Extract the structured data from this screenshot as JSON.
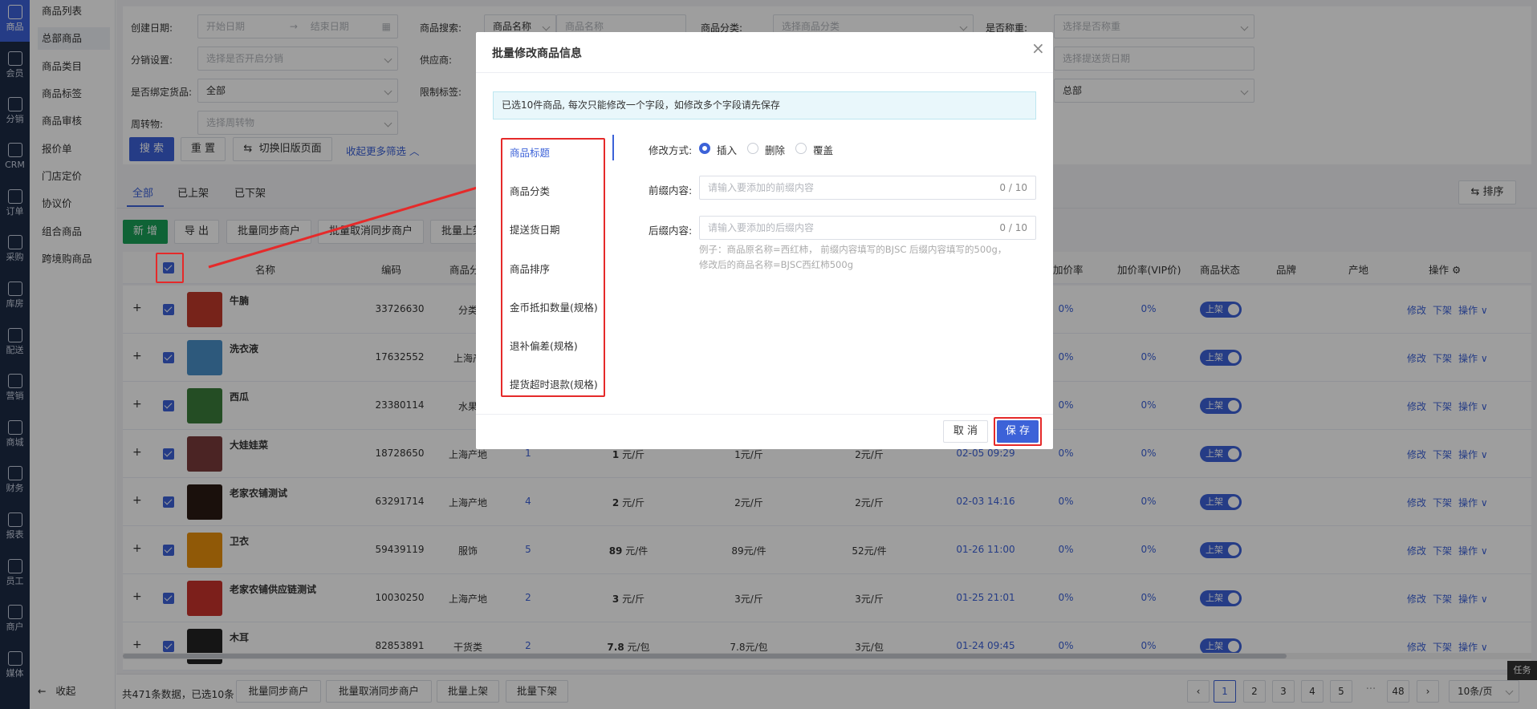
{
  "nav": {
    "items": [
      {
        "label": "商品",
        "icon": "goods-icon",
        "active": true
      },
      {
        "label": "会员",
        "icon": "member-icon"
      },
      {
        "label": "分销",
        "icon": "distribution-icon"
      },
      {
        "label": "CRM",
        "icon": "crm-icon"
      },
      {
        "label": "订单",
        "icon": "order-icon"
      },
      {
        "label": "采购",
        "icon": "purchase-icon"
      },
      {
        "label": "库房",
        "icon": "warehouse-icon"
      },
      {
        "label": "配送",
        "icon": "delivery-icon"
      },
      {
        "label": "营销",
        "icon": "marketing-icon"
      },
      {
        "label": "商城",
        "icon": "mall-icon"
      },
      {
        "label": "财务",
        "icon": "finance-icon"
      },
      {
        "label": "报表",
        "icon": "report-icon"
      },
      {
        "label": "员工",
        "icon": "staff-icon"
      },
      {
        "label": "商户",
        "icon": "merchant-icon"
      },
      {
        "label": "媒体",
        "icon": "media-icon"
      }
    ]
  },
  "subnav": {
    "items": [
      "商品列表",
      "总部商品",
      "商品类目",
      "商品标签",
      "商品审核",
      "报价单",
      "门店定价",
      "协议价",
      "组合商品",
      "跨境购商品"
    ],
    "active_index": 1,
    "collapse": "收起"
  },
  "filters": {
    "create_date": {
      "label": "创建日期:",
      "start": "开始日期",
      "sep": "→",
      "end": "结束日期"
    },
    "search": {
      "label": "商品搜索:",
      "type": "商品名称",
      "placeholder": "商品名称"
    },
    "category": {
      "label": "商品分类:",
      "placeholder": "选择商品分类"
    },
    "weigh": {
      "label": "是否称重:",
      "placeholder": "选择是否称重"
    },
    "distribution": {
      "label": "分销设置:",
      "placeholder": "选择是否开启分销"
    },
    "supplier": {
      "label": "供应商:"
    },
    "delivery_date": {
      "placeholder": "选择提送货日期"
    },
    "bind_goods": {
      "label": "是否绑定货品:",
      "value": "全部"
    },
    "limit_tag": {
      "label": "限制标签:"
    },
    "extra_select": {
      "value": "总部"
    },
    "turnover": {
      "label": "周转物:",
      "placeholder": "选择周转物"
    },
    "search_btn": "搜 索",
    "reset_btn": "重 置",
    "switch_btn": "切换旧版页面",
    "collapse_link": "收起更多筛选"
  },
  "tabs": [
    "全部",
    "已上架",
    "已下架"
  ],
  "sort_btn": "排序",
  "toolbar": {
    "add": "新 增",
    "export": "导 出",
    "sync": "批量同步商户",
    "unsync": "批量取消同步商户",
    "shelf": "批量上架"
  },
  "table": {
    "headers": {
      "name": "名称",
      "code": "编码",
      "category": "商品分",
      "markup": "加价率",
      "markup_vip": "加价率(VIP价)",
      "status": "商品状态",
      "brand": "品牌",
      "origin": "产地",
      "ops": "操作"
    },
    "rows": [
      {
        "name": "牛腩",
        "code": "33726630",
        "category": "分类",
        "sort": "",
        "price_num": "",
        "price_unit": "",
        "p2": "",
        "p3": "",
        "date": "",
        "markup": "0%",
        "vip": "0%",
        "status": "上架",
        "thumb": "#c0392b"
      },
      {
        "name": "洗衣液",
        "code": "17632552",
        "category": "上海产",
        "sort": "",
        "price_num": "",
        "price_unit": "",
        "p2": "",
        "p3": "",
        "date": "",
        "markup": "0%",
        "vip": "0%",
        "status": "上架",
        "thumb": "#4a90c8"
      },
      {
        "name": "西瓜",
        "code": "23380114",
        "category": "水果",
        "sort": "",
        "price_num": "",
        "price_unit": "",
        "p2": "",
        "p3": "",
        "date": "",
        "markup": "0%",
        "vip": "0%",
        "status": "上架",
        "thumb": "#3b7d3b"
      },
      {
        "name": "大娃娃菜",
        "code": "18728650",
        "category": "上海产地",
        "sort": "1",
        "price_num": "1",
        "price_unit": "元/斤",
        "p2": "1元/斤",
        "p3": "2元/斤",
        "date": "02-05 09:29",
        "markup": "0%",
        "vip": "0%",
        "status": "上架",
        "thumb": "#7a3a3a"
      },
      {
        "name": "老家农铺测试",
        "code": "63291714",
        "category": "上海产地",
        "sort": "4",
        "price_num": "2",
        "price_unit": "元/斤",
        "p2": "2元/斤",
        "p3": "2元/斤",
        "date": "02-03 14:16",
        "markup": "0%",
        "vip": "0%",
        "status": "上架",
        "thumb": "#2b1a14"
      },
      {
        "name": "卫衣",
        "code": "59439119",
        "category": "服饰",
        "sort": "5",
        "price_num": "89",
        "price_unit": "元/件",
        "p2": "89元/件",
        "p3": "52元/件",
        "date": "01-26 11:00",
        "markup": "0%",
        "vip": "0%",
        "status": "上架",
        "thumb": "#e8900c"
      },
      {
        "name": "老家农铺供应链测试",
        "code": "10030250",
        "category": "上海产地",
        "sort": "2",
        "price_num": "3",
        "price_unit": "元/斤",
        "p2": "3元/斤",
        "p3": "3元/斤",
        "date": "01-25 21:01",
        "markup": "0%",
        "vip": "0%",
        "status": "上架",
        "thumb": "#c8332d"
      },
      {
        "name": "木耳",
        "code": "82853891",
        "category": "干货类",
        "sort": "2",
        "price_num": "7.8",
        "price_unit": "元/包",
        "p2": "7.8元/包",
        "p3": "3元/包",
        "date": "01-24 09:45",
        "markup": "0%",
        "vip": "0%",
        "status": "上架",
        "thumb": "#222222"
      }
    ],
    "ops": {
      "edit": "修改",
      "off": "下架",
      "more": "操作"
    }
  },
  "footer": {
    "summary": "共471条数据，已选10条",
    "sync": "批量同步商户",
    "unsync": "批量取消同步商户",
    "on": "批量上架",
    "off": "批量下架",
    "pages": [
      "1",
      "2",
      "3",
      "4",
      "5",
      "···",
      "48"
    ],
    "page_size": "10条/页"
  },
  "task_badge": "任务",
  "modal": {
    "title": "批量修改商品信息",
    "notice": "已选10件商品, 每次只能修改一个字段，如修改多个字段请先保存",
    "fields": [
      "商品标题",
      "商品分类",
      "提送货日期",
      "商品排序",
      "金币抵扣数量(规格)",
      "退补偏差(规格)",
      "提货超时退款(规格)"
    ],
    "mode_label": "修改方式:",
    "modes": [
      "插入",
      "删除",
      "覆盖"
    ],
    "prefix_label": "前缀内容:",
    "prefix_placeholder": "请输入要添加的前缀内容",
    "prefix_count": "0 / 10",
    "suffix_label": "后缀内容:",
    "suffix_placeholder": "请输入要添加的后缀内容",
    "suffix_count": "0 / 10",
    "example_1": "例子：商品原名称=西红柿，  前缀内容填写的BJSC 后缀内容填写的500g，",
    "example_2": "修改后的商品名称=BJSC西红柿500g",
    "cancel": "取 消",
    "save": "保 存"
  },
  "colors": {
    "accent": "#3c62d8",
    "nav_bg": "#1c2a45",
    "annotation_red": "#e52a2a"
  }
}
